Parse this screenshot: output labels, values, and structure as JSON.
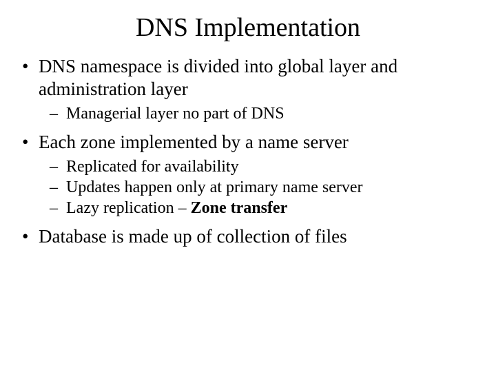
{
  "slide": {
    "title": "DNS Implementation",
    "bullets": [
      {
        "text": "DNS namespace is divided into global layer and administration layer",
        "sub": [
          "Managerial layer no part of DNS"
        ]
      },
      {
        "text": "Each zone implemented by a name server",
        "sub": [
          "Replicated for availability",
          "Updates happen only at primary name server"
        ],
        "sub_special": {
          "prefix": "Lazy replication – ",
          "bold": "Zone transfer"
        }
      },
      {
        "text": "Database is made up of collection of files",
        "sub": []
      }
    ]
  }
}
